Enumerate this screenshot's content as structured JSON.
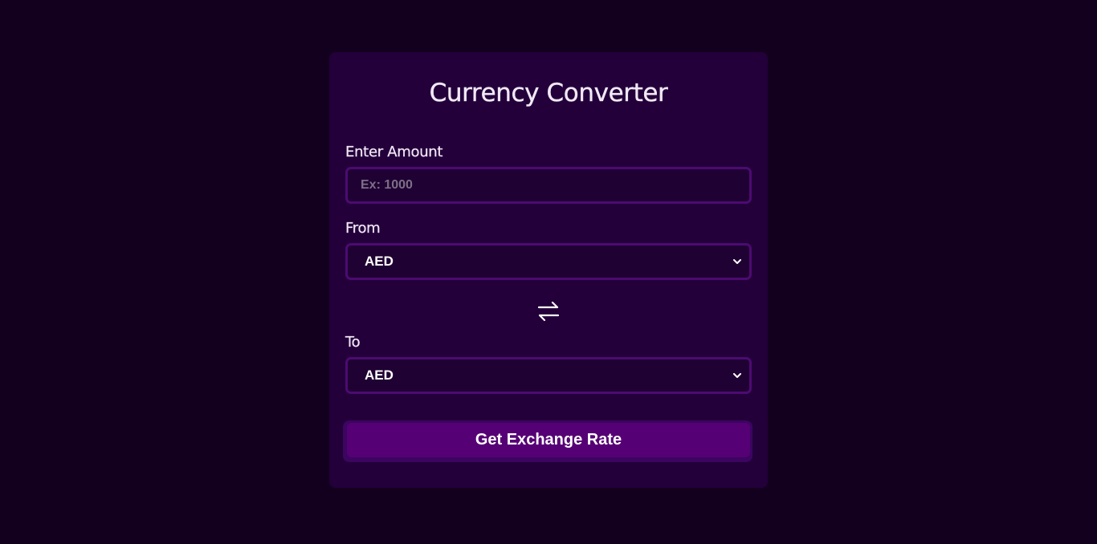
{
  "card": {
    "title": "Currency Converter"
  },
  "amount": {
    "label": "Enter Amount",
    "placeholder": "Ex: 1000",
    "value": ""
  },
  "from": {
    "label": "From",
    "selected": "AED"
  },
  "to": {
    "label": "To",
    "selected": "AED"
  },
  "swap": {
    "icon": "swap-arrows-icon"
  },
  "action": {
    "label": "Get Exchange Rate"
  },
  "colors": {
    "background": "#13001f",
    "card": "#23003a",
    "field_border": "#4d0a72",
    "button": "#560075"
  }
}
